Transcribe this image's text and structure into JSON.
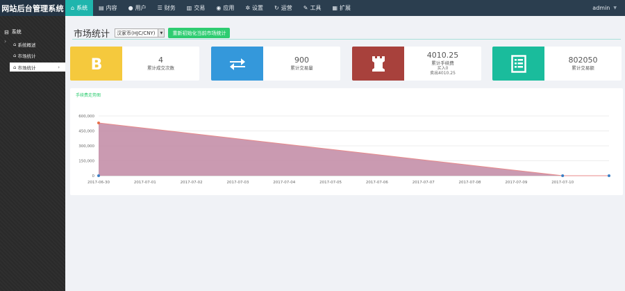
{
  "brand": "网站后台管理系统",
  "nav": [
    {
      "icon": "home-icon",
      "glyph": "⌂",
      "label": "系统",
      "active": true
    },
    {
      "icon": "content-icon",
      "glyph": "▤",
      "label": "内容"
    },
    {
      "icon": "user-icon",
      "glyph": "●",
      "label": "用户"
    },
    {
      "icon": "finance-icon",
      "glyph": "☰",
      "label": "财务"
    },
    {
      "icon": "trade-icon",
      "glyph": "▥",
      "label": "交易"
    },
    {
      "icon": "apps-icon",
      "glyph": "◉",
      "label": "应用"
    },
    {
      "icon": "gear-icon",
      "glyph": "✲",
      "label": "设置"
    },
    {
      "icon": "operation-icon",
      "glyph": "↻",
      "label": "运营"
    },
    {
      "icon": "wrench-icon",
      "glyph": "✎",
      "label": "工具"
    },
    {
      "icon": "extend-icon",
      "glyph": "▦",
      "label": "扩展"
    }
  ],
  "user": {
    "name": "admin"
  },
  "sidebar": {
    "group": "系统",
    "items": [
      {
        "label": "系统概述"
      },
      {
        "label": "市场统计"
      },
      {
        "label": "市场统计",
        "active": true
      }
    ]
  },
  "header": {
    "title": "市场统计",
    "select_value": "汉家币(HJC/CNY)",
    "refresh_label": "重新初始化当前市场统计"
  },
  "cards": [
    {
      "icon": "bitcoin-icon",
      "color": "#f5c93d",
      "value": "4",
      "label": "累计成交次数"
    },
    {
      "icon": "exchange-icon",
      "color": "#3498db",
      "value": "900",
      "label": "累计交易量"
    },
    {
      "icon": "rook-icon",
      "color": "#a8413c",
      "value": "4010.25",
      "label": "累计手续费",
      "sub1": "买入0",
      "sub2": "卖出4010.25"
    },
    {
      "icon": "list-icon",
      "color": "#1abc9c",
      "value": "802050",
      "label": "累计交易额"
    }
  ],
  "chart_data": {
    "type": "area",
    "title": "手续费走势图",
    "x": [
      "2017-06-30",
      "2017-07-01",
      "2017-07-02",
      "2017-07-03",
      "2017-07-04",
      "2017-07-05",
      "2017-07-06",
      "2017-07-07",
      "2017-07-08",
      "2017-07-09",
      "2017-07-10"
    ],
    "points": [
      {
        "x": "2017-06-30",
        "y": 530000
      },
      {
        "x": "2017-07-10",
        "y": 0
      },
      {
        "x": "2017-07-11",
        "y": 0
      }
    ],
    "ylim": [
      0,
      600000
    ],
    "yticks": [
      0,
      150000,
      300000,
      450000,
      600000
    ],
    "ytick_labels": [
      "0",
      "150,000",
      "300,000",
      "450,000",
      "600,000"
    ],
    "fill_color": "#c48fa8",
    "line_color": "#e88a8a",
    "grid": true
  }
}
